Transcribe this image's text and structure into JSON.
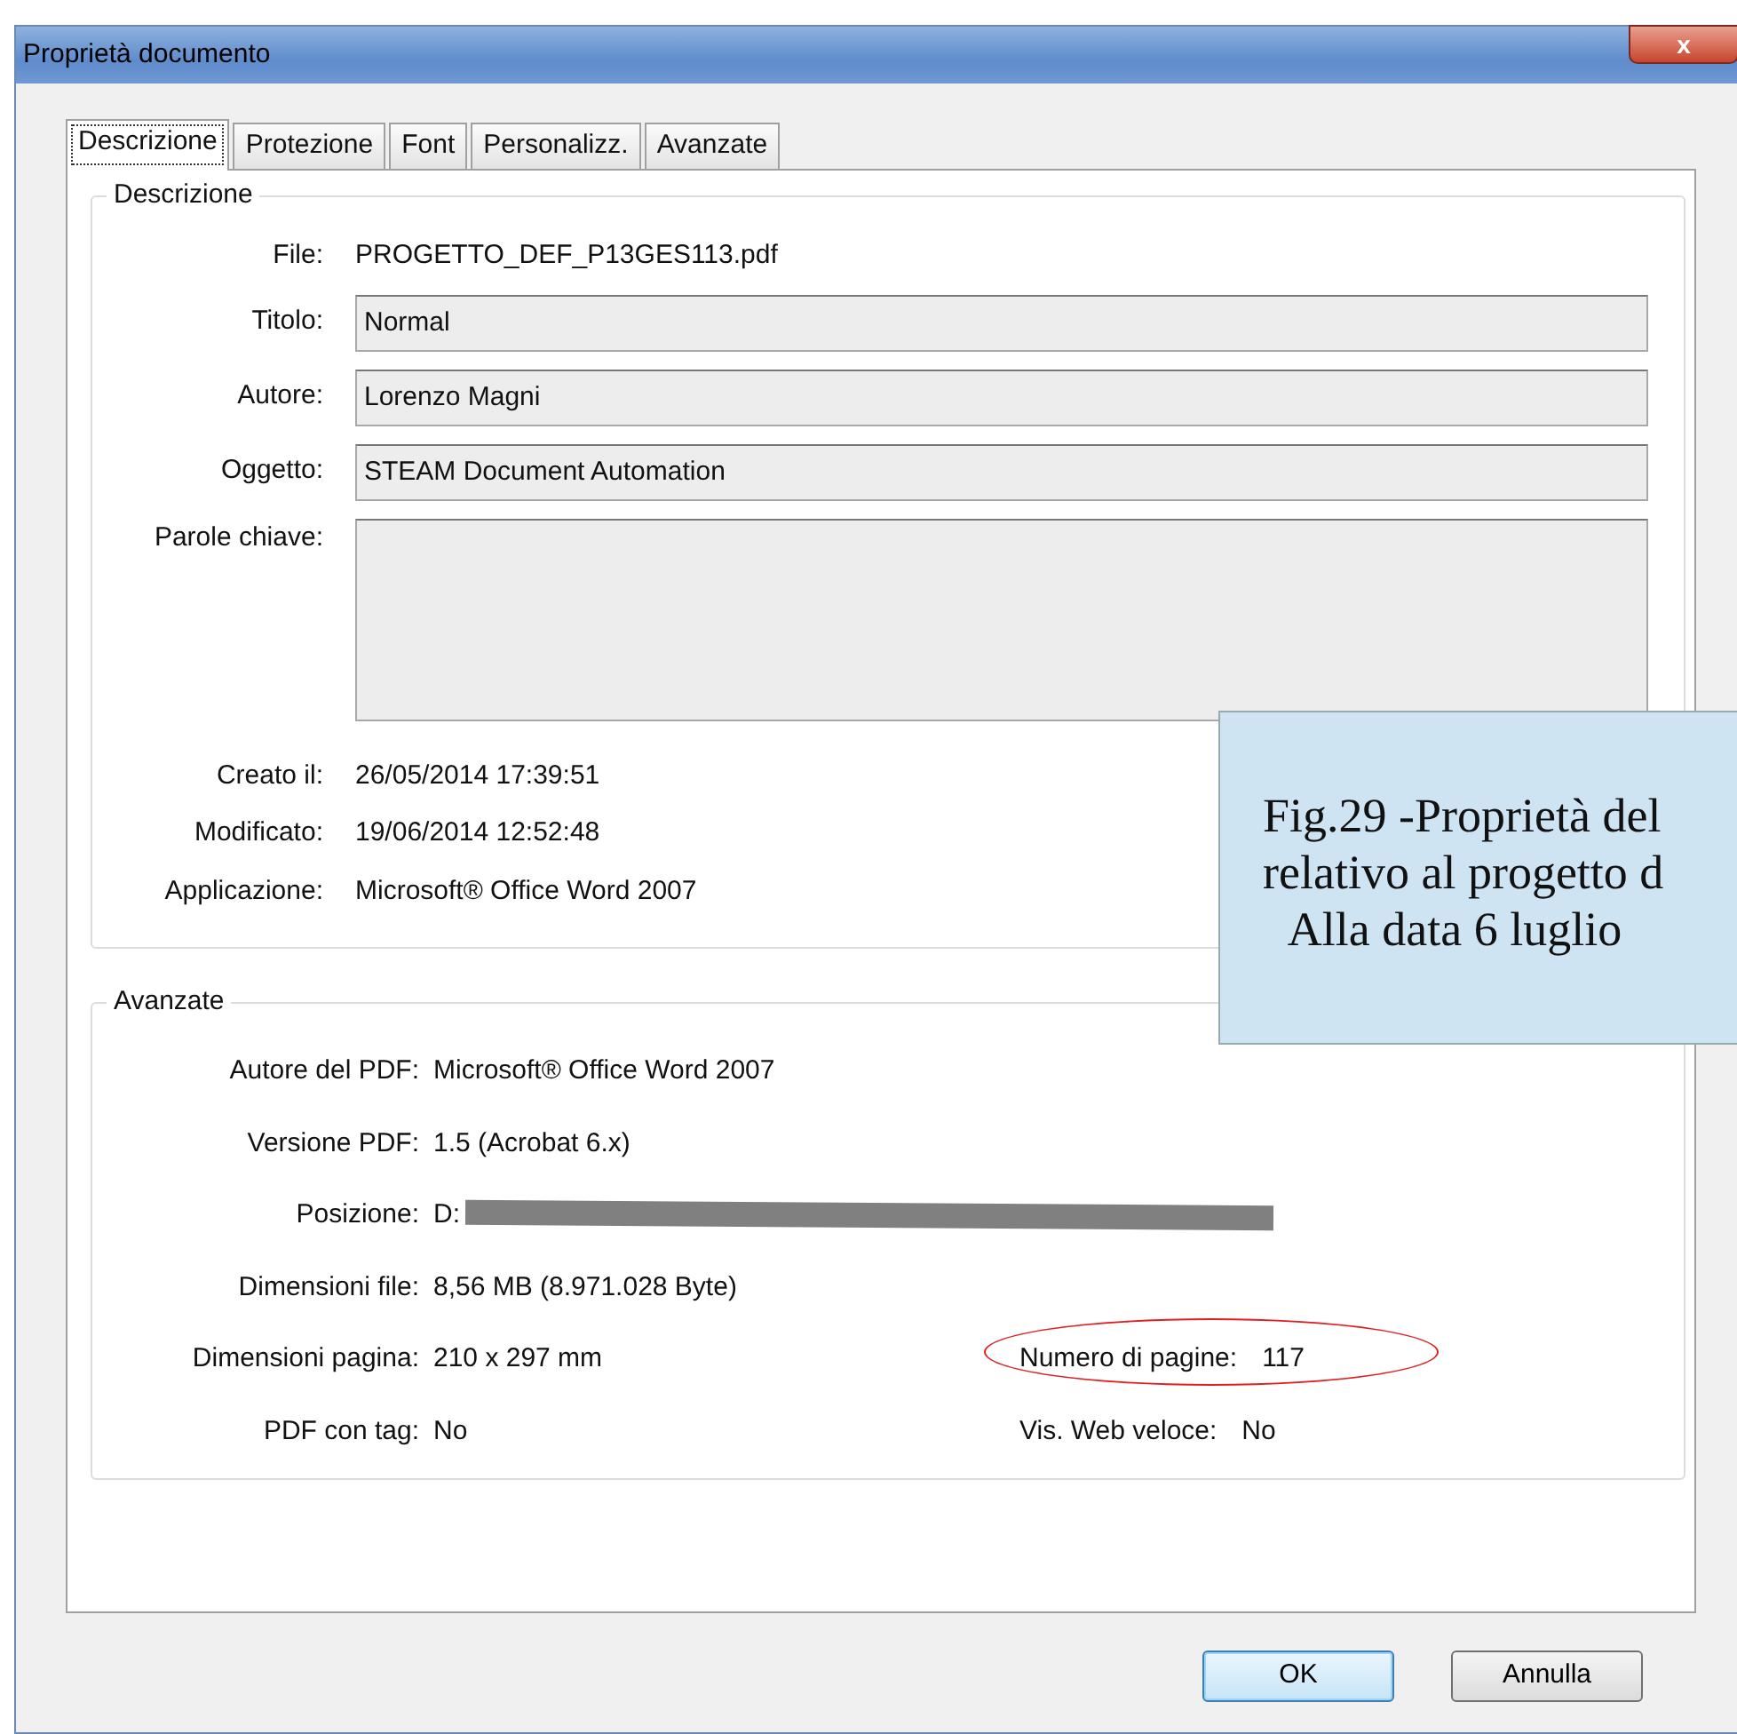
{
  "window": {
    "title": "Proprietà documento",
    "close": "x"
  },
  "tabs": [
    {
      "label": "Descrizione",
      "selected": true
    },
    {
      "label": "Protezione",
      "selected": false
    },
    {
      "label": "Font",
      "selected": false
    },
    {
      "label": "Personalizz.",
      "selected": false
    },
    {
      "label": "Avanzate",
      "selected": false
    }
  ],
  "description": {
    "title": "Descrizione",
    "rows": [
      {
        "kind": "static",
        "label": "File:",
        "value": "PROGETTO_DEF_P13GES113.pdf"
      },
      {
        "kind": "field",
        "label": "Titolo:",
        "value": "Normal"
      },
      {
        "kind": "field",
        "label": "Autore:",
        "value": "Lorenzo Magni"
      },
      {
        "kind": "field",
        "label": "Oggetto:",
        "value": "STEAM Document Automation"
      },
      {
        "kind": "area",
        "label": "Parole chiave:"
      },
      {
        "kind": "static",
        "label": "Creato il:",
        "value": "26/05/2014 17:39:51"
      },
      {
        "kind": "static",
        "label": "Modificato:",
        "value": "19/06/2014 12:52:48"
      },
      {
        "kind": "static",
        "label": "Applicazione:",
        "value": "Microsoft® Office Word 2007"
      }
    ]
  },
  "advanced": {
    "title": "Avanzate",
    "rows": [
      {
        "label": "Autore del PDF:",
        "value": "Microsoft® Office Word 2007"
      },
      {
        "label": "Versione PDF:",
        "value": "1.5 (Acrobat 6.x)"
      },
      {
        "label": "Posizione:",
        "value": "D:",
        "redacted": true
      },
      {
        "label": "Dimensioni file:",
        "value": "8,56 MB (8.971.028 Byte)"
      },
      {
        "label": "Dimensioni pagina:",
        "value": "210 x 297 mm",
        "right": {
          "label": "Numero di pagine:",
          "value": "117",
          "highlighted": true
        }
      },
      {
        "label": "PDF con tag:",
        "value": "No",
        "right": {
          "label": "Vis. Web veloce:",
          "value": "No",
          "highlighted": false
        }
      }
    ]
  },
  "buttons": [
    {
      "label": "OK",
      "default": true
    },
    {
      "label": "Annulla",
      "default": false
    }
  ],
  "caption": {
    "lines": [
      "Fig.29 -Proprietà del",
      "relativo al progetto d",
      "Alla data 6 luglio"
    ]
  }
}
